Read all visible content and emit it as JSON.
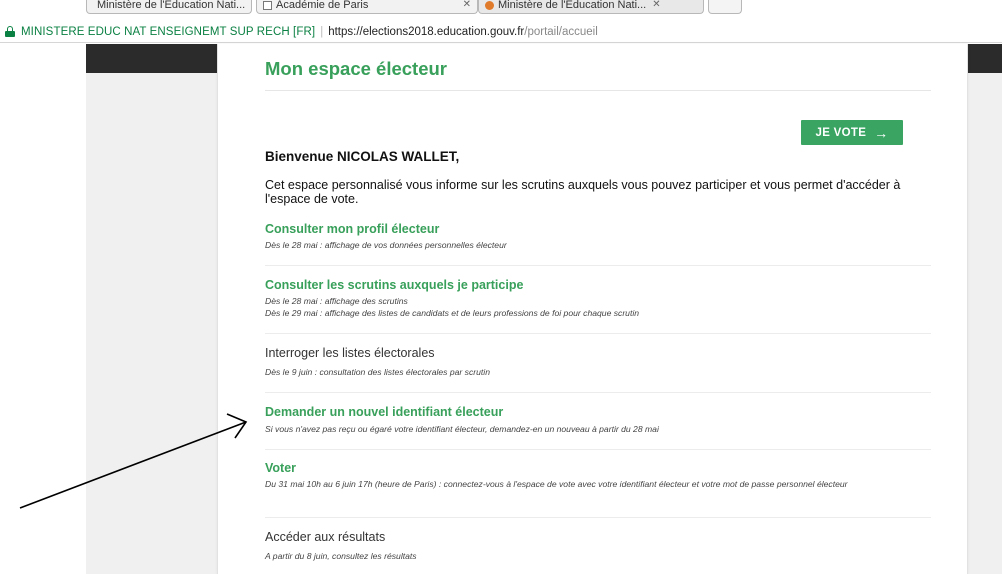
{
  "browser": {
    "tabs": [
      {
        "label": "Ministère de l'Éducation Nati...",
        "icon": "page-icon"
      },
      {
        "label": "Académie de Paris",
        "icon": "document-icon"
      },
      {
        "label": "Ministère de l'Éducation Nati...",
        "icon": "orange-circle-icon"
      }
    ],
    "cert_name": "MINISTERE EDUC NAT ENSEIGNEMT SUP RECH [FR]",
    "url_host": "https://elections2018.education.gouv.fr",
    "url_path": "/portail/accueil"
  },
  "page": {
    "title": "Mon espace électeur",
    "vote_button": "JE VOTE",
    "welcome": "Bienvenue NICOLAS WALLET,",
    "intro": "Cet espace personnalisé vous informe sur les scrutins auxquels vous pouvez participer et vous permet d'accéder à l'espace de vote.",
    "sections": [
      {
        "title": "Consulter mon profil électeur",
        "desc": [
          "Dès le 28 mai : affichage de vos données personnelles électeur"
        ]
      },
      {
        "title": "Consulter les scrutins auxquels je participe",
        "desc": [
          "Dès le 28 mai : affichage des scrutins",
          "Dès le 29 mai : affichage des listes de candidats et de leurs professions de foi pour chaque scrutin"
        ]
      },
      {
        "title": "Interroger les listes électorales",
        "desc": [
          "Dès le 9 juin : consultation des listes électorales par scrutin"
        ]
      },
      {
        "title": "Demander un nouvel identifiant électeur",
        "desc": [
          "Si vous n'avez pas reçu ou égaré votre identifiant électeur, demandez-en un nouveau à partir du 28 mai"
        ]
      },
      {
        "title": "Voter",
        "desc": [
          "Du 31 mai 10h au 6 juin 17h (heure de Paris) : connectez-vous à l'espace de vote avec votre identifiant électeur et votre mot de passe personnel électeur"
        ]
      },
      {
        "title": "Accéder aux résultats",
        "desc": [
          "A partir du 8 juin, consultez les résultats"
        ]
      }
    ]
  },
  "colors": {
    "accent_green": "#38a05a",
    "button_green": "#3aa463",
    "cert_green": "#0b8043",
    "header_band": "#2b2b2b"
  }
}
